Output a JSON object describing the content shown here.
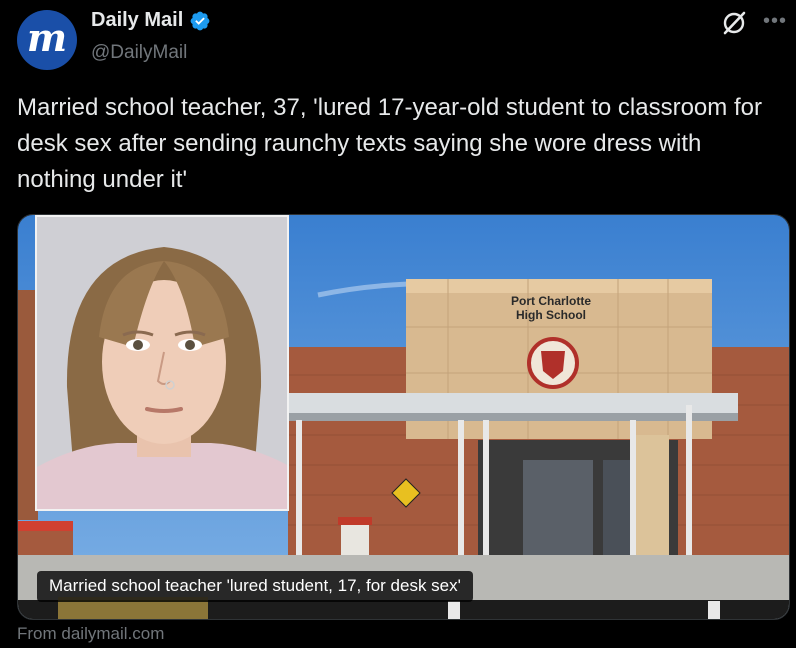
{
  "author": {
    "display_name": "Daily Mail",
    "handle": "@DailyMail",
    "avatar_letter": "m",
    "verified": true,
    "brand_color": "#1a4fa8",
    "verified_color": "#1d9bf0"
  },
  "tweet": {
    "text": "Married school teacher, 37, 'lured 17-year-old student to classroom for desk sex after sending raunchy texts saying she wore dress with nothing under it'"
  },
  "card": {
    "caption": "Married school teacher 'lured student, 17, for desk sex'",
    "sign_line1": "Port Charlotte",
    "sign_line2": "High School",
    "source_text": "From dailymail.com"
  },
  "icons": {
    "grok": "grok-icon",
    "more": "more-icon",
    "verified": "verified-badge-icon"
  }
}
